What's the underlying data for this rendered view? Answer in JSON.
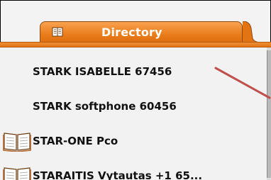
{
  "tab": {
    "label": "Directory",
    "icon": "book-icon"
  },
  "list": {
    "items": [
      {
        "label": "STARK ISABELLE 67456",
        "icon": null
      },
      {
        "label": "STARK softphone 60456",
        "icon": null
      },
      {
        "label": "STAR-ONE Pco",
        "icon": "book-icon"
      },
      {
        "label": "STARAITIS Vytautas +1 65...",
        "icon": "book-icon"
      }
    ]
  },
  "colors": {
    "tab_orange": "#ea7e1c",
    "annotation_arrow": "#c0504d"
  }
}
